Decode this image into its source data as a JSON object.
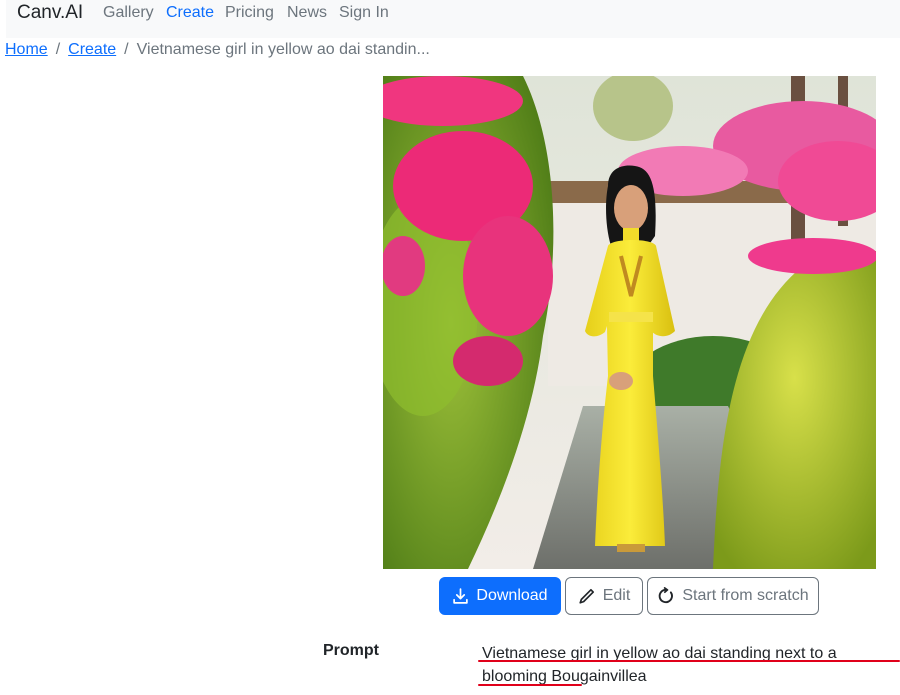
{
  "nav": {
    "brand": "Canv.AI",
    "items": [
      {
        "label": "Gallery",
        "active": false
      },
      {
        "label": "Create",
        "active": true
      },
      {
        "label": "Pricing",
        "active": false
      },
      {
        "label": "News",
        "active": false
      },
      {
        "label": "Sign In",
        "active": false
      }
    ]
  },
  "breadcrumb": {
    "home": "Home",
    "create": "Create",
    "current": "Vietnamese girl in yellow ao dai standin..."
  },
  "actions": {
    "download": "Download",
    "edit": "Edit",
    "start_from_scratch": "Start from scratch"
  },
  "prompt": {
    "label": "Prompt",
    "text": "Vietnamese girl in yellow ao dai standing next to a blooming Bougainvillea"
  },
  "colors": {
    "accent": "#0d6efd",
    "annotation": "#e0001a"
  }
}
